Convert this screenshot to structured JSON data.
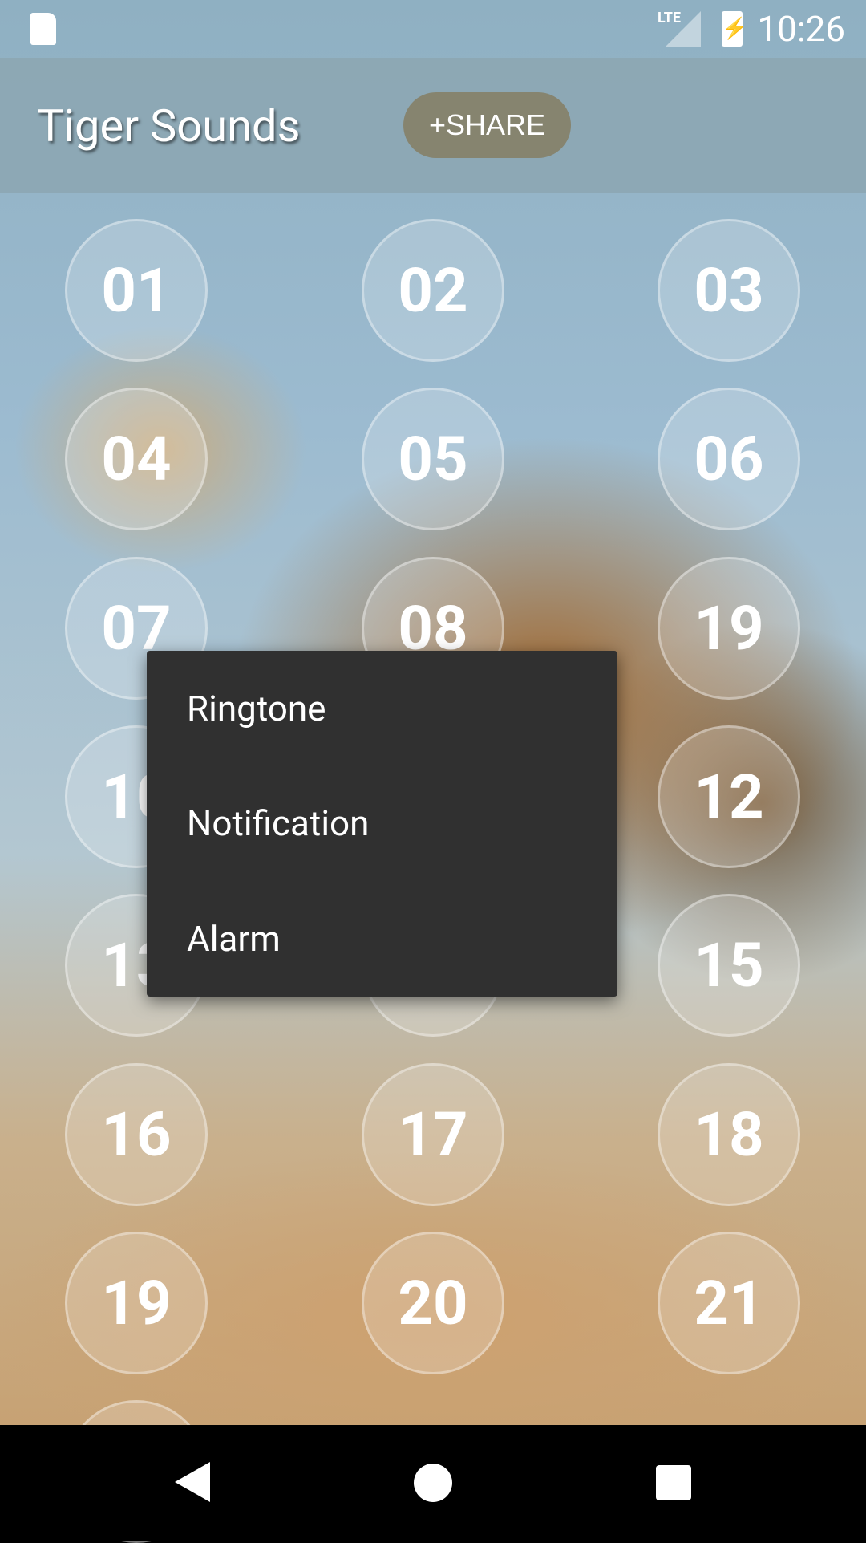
{
  "status_bar": {
    "time": "10:26",
    "network": "LTE",
    "icons": [
      "sd-card-icon",
      "signal-icon",
      "battery-charging-icon"
    ]
  },
  "toolbar": {
    "title": "Tiger Sounds",
    "share_label": "+SHARE"
  },
  "sound_buttons": [
    "01",
    "02",
    "03",
    "04",
    "05",
    "06",
    "07",
    "08",
    "19",
    "10",
    "",
    "12",
    "13",
    "",
    "15",
    "16",
    "17",
    "18",
    "19",
    "20",
    "21"
  ],
  "context_menu": {
    "items": [
      "Ringtone",
      "Notification",
      "Alarm"
    ]
  },
  "nav_bar": {
    "icons": [
      "back-icon",
      "home-icon",
      "recents-icon"
    ]
  }
}
